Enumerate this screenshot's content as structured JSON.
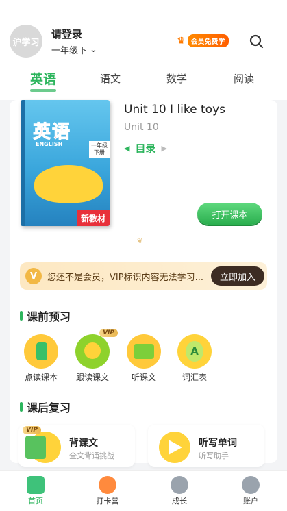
{
  "header": {
    "avatar_text": "沪学习",
    "login": "请登录",
    "grade": "一年级下",
    "vip_free": "会员免费学"
  },
  "tabs": [
    {
      "label": "英语",
      "active": true
    },
    {
      "label": "语文"
    },
    {
      "label": "数学"
    },
    {
      "label": "阅读"
    }
  ],
  "book": {
    "cover_title": "英语",
    "cover_subtitle": "ENGLISH",
    "cover_grade": "一年级\n下册",
    "cover_tag": "新教材",
    "unit_title": "Unit 10 I like toys",
    "unit_sub": "Unit 10",
    "toc": "目录",
    "open_button": "打开课本"
  },
  "vip_banner": {
    "message": "您还不是会员，VIP标识内容无法学习...",
    "join": "立即加入"
  },
  "preview": {
    "title": "课前预习",
    "items": [
      {
        "label": "点读课本"
      },
      {
        "label": "跟读课文",
        "vip": "VIP"
      },
      {
        "label": "听课文"
      },
      {
        "label": "词汇表",
        "glyph": "A"
      }
    ]
  },
  "review": {
    "title": "课后复习",
    "items": [
      {
        "title": "背课文",
        "sub": "全文背诵挑战",
        "vip": "VIP"
      },
      {
        "title": "听写单词",
        "sub": "听写助手"
      }
    ]
  },
  "nav": [
    {
      "label": "首页",
      "active": true
    },
    {
      "label": "打卡营"
    },
    {
      "label": "成长"
    },
    {
      "label": "账户"
    }
  ],
  "colors": {
    "accent": "#2db55d",
    "vip": "#f2b845"
  }
}
